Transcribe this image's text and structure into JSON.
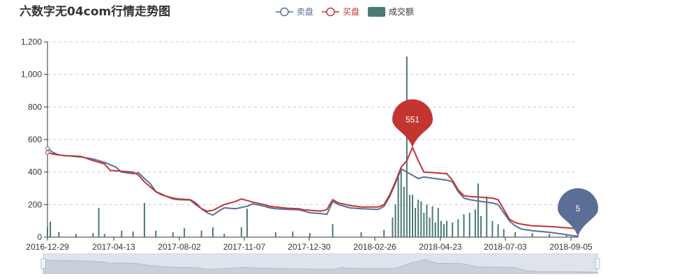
{
  "chart_data": {
    "type": "line",
    "title": "六数字无04com行情走势图",
    "legend": [
      {
        "name": "卖盘",
        "kind": "line",
        "color": "#5b6e96"
      },
      {
        "name": "买盘",
        "kind": "line",
        "color": "#c23531"
      },
      {
        "name": "成交额",
        "kind": "bar",
        "color": "#4a7a74"
      }
    ],
    "legend_position": "top-center",
    "x_tick_labels": [
      "2016-12-29",
      "2017-04-13",
      "2017-08-02",
      "2017-11-07",
      "2017-12-30",
      "2018-02-26",
      "2018-04-23",
      "2018-07-03",
      "2018-09-05"
    ],
    "ylim": [
      0,
      1200
    ],
    "y_ticks": [
      0,
      200,
      400,
      600,
      800,
      1000,
      1200
    ],
    "y_tick_labels": [
      "0",
      "200",
      "400",
      "600",
      "800",
      "1,000",
      "1,200"
    ],
    "grid": "horizontal-dashed",
    "series": [
      {
        "name": "卖盘",
        "color": "#5b6e96",
        "points": [
          [
            0,
            545
          ],
          [
            2,
            520
          ],
          [
            4,
            505
          ],
          [
            8,
            498
          ],
          [
            12,
            492
          ],
          [
            16,
            480
          ],
          [
            20,
            460
          ],
          [
            24,
            430
          ],
          [
            26,
            400
          ],
          [
            30,
            390
          ],
          [
            32,
            395
          ],
          [
            34,
            360
          ],
          [
            36,
            330
          ],
          [
            38,
            280
          ],
          [
            40,
            265
          ],
          [
            42,
            248
          ],
          [
            44,
            235
          ],
          [
            46,
            230
          ],
          [
            50,
            228
          ],
          [
            52,
            200
          ],
          [
            54,
            175
          ],
          [
            56,
            150
          ],
          [
            58,
            135
          ],
          [
            60,
            160
          ],
          [
            62,
            180
          ],
          [
            66,
            175
          ],
          [
            70,
            190
          ],
          [
            72,
            205
          ],
          [
            76,
            190
          ],
          [
            78,
            180
          ],
          [
            80,
            175
          ],
          [
            84,
            170
          ],
          [
            88,
            168
          ],
          [
            90,
            160
          ],
          [
            92,
            150
          ],
          [
            96,
            145
          ],
          [
            98,
            140
          ],
          [
            100,
            220
          ],
          [
            102,
            200
          ],
          [
            106,
            180
          ],
          [
            110,
            175
          ],
          [
            116,
            170
          ],
          [
            118,
            190
          ],
          [
            120,
            250
          ],
          [
            122,
            330
          ],
          [
            124,
            420
          ],
          [
            126,
            400
          ],
          [
            128,
            380
          ],
          [
            130,
            360
          ],
          [
            132,
            370
          ],
          [
            136,
            360
          ],
          [
            140,
            350
          ],
          [
            142,
            340
          ],
          [
            144,
            280
          ],
          [
            146,
            240
          ],
          [
            148,
            230
          ],
          [
            152,
            220
          ],
          [
            156,
            210
          ],
          [
            158,
            200
          ],
          [
            160,
            150
          ],
          [
            162,
            100
          ],
          [
            164,
            70
          ],
          [
            166,
            50
          ],
          [
            170,
            40
          ],
          [
            176,
            30
          ],
          [
            180,
            20
          ],
          [
            184,
            10
          ],
          [
            186,
            5
          ]
        ]
      },
      {
        "name": "买盘",
        "color": "#c23531",
        "points": [
          [
            0,
            520
          ],
          [
            2,
            510
          ],
          [
            6,
            500
          ],
          [
            10,
            498
          ],
          [
            12,
            495
          ],
          [
            16,
            470
          ],
          [
            20,
            450
          ],
          [
            22,
            410
          ],
          [
            26,
            405
          ],
          [
            30,
            400
          ],
          [
            32,
            380
          ],
          [
            34,
            340
          ],
          [
            36,
            310
          ],
          [
            38,
            280
          ],
          [
            40,
            260
          ],
          [
            42,
            250
          ],
          [
            44,
            240
          ],
          [
            46,
            235
          ],
          [
            50,
            230
          ],
          [
            52,
            210
          ],
          [
            54,
            175
          ],
          [
            56,
            160
          ],
          [
            58,
            165
          ],
          [
            62,
            200
          ],
          [
            66,
            220
          ],
          [
            68,
            235
          ],
          [
            72,
            215
          ],
          [
            76,
            200
          ],
          [
            78,
            190
          ],
          [
            80,
            185
          ],
          [
            84,
            178
          ],
          [
            88,
            175
          ],
          [
            90,
            168
          ],
          [
            92,
            165
          ],
          [
            96,
            160
          ],
          [
            98,
            170
          ],
          [
            100,
            230
          ],
          [
            102,
            210
          ],
          [
            106,
            195
          ],
          [
            110,
            185
          ],
          [
            116,
            185
          ],
          [
            118,
            200
          ],
          [
            120,
            260
          ],
          [
            122,
            340
          ],
          [
            124,
            430
          ],
          [
            126,
            470
          ],
          [
            128,
            551
          ],
          [
            130,
            470
          ],
          [
            132,
            400
          ],
          [
            136,
            395
          ],
          [
            140,
            390
          ],
          [
            142,
            350
          ],
          [
            144,
            290
          ],
          [
            146,
            255
          ],
          [
            148,
            250
          ],
          [
            152,
            245
          ],
          [
            156,
            240
          ],
          [
            158,
            230
          ],
          [
            160,
            170
          ],
          [
            162,
            110
          ],
          [
            164,
            90
          ],
          [
            166,
            80
          ],
          [
            170,
            70
          ],
          [
            176,
            65
          ],
          [
            180,
            60
          ],
          [
            184,
            55
          ],
          [
            186,
            50
          ]
        ]
      },
      {
        "name": "成交额",
        "color": "#4a7a74",
        "bars": [
          [
            0,
            60
          ],
          [
            1,
            95
          ],
          [
            4,
            30
          ],
          [
            10,
            20
          ],
          [
            16,
            25
          ],
          [
            18,
            180
          ],
          [
            20,
            20
          ],
          [
            26,
            40
          ],
          [
            30,
            35
          ],
          [
            34,
            210
          ],
          [
            38,
            40
          ],
          [
            44,
            30
          ],
          [
            48,
            55
          ],
          [
            54,
            40
          ],
          [
            58,
            60
          ],
          [
            62,
            20
          ],
          [
            68,
            60
          ],
          [
            70,
            175
          ],
          [
            80,
            30
          ],
          [
            86,
            35
          ],
          [
            92,
            25
          ],
          [
            100,
            80
          ],
          [
            110,
            30
          ],
          [
            118,
            45
          ],
          [
            121,
            120
          ],
          [
            122,
            200
          ],
          [
            123,
            390
          ],
          [
            124,
            420
          ],
          [
            125,
            310
          ],
          [
            126,
            1110
          ],
          [
            127,
            260
          ],
          [
            128,
            260
          ],
          [
            129,
            180
          ],
          [
            130,
            230
          ],
          [
            131,
            220
          ],
          [
            132,
            150
          ],
          [
            133,
            200
          ],
          [
            134,
            120
          ],
          [
            135,
            190
          ],
          [
            136,
            90
          ],
          [
            137,
            180
          ],
          [
            138,
            100
          ],
          [
            139,
            80
          ],
          [
            140,
            100
          ],
          [
            142,
            90
          ],
          [
            144,
            110
          ],
          [
            146,
            140
          ],
          [
            148,
            150
          ],
          [
            150,
            170
          ],
          [
            151,
            330
          ],
          [
            152,
            130
          ],
          [
            154,
            250
          ],
          [
            156,
            100
          ],
          [
            158,
            80
          ],
          [
            160,
            50
          ],
          [
            164,
            30
          ],
          [
            170,
            25
          ],
          [
            176,
            20
          ],
          [
            182,
            15
          ],
          [
            186,
            10
          ]
        ]
      }
    ],
    "markers": [
      {
        "series": "买盘",
        "label": "551",
        "x": 128,
        "y": 551,
        "color": "#c23531"
      },
      {
        "series": "卖盘",
        "label": "5",
        "x": 186,
        "y": 5,
        "color": "#5b6e96"
      }
    ]
  }
}
